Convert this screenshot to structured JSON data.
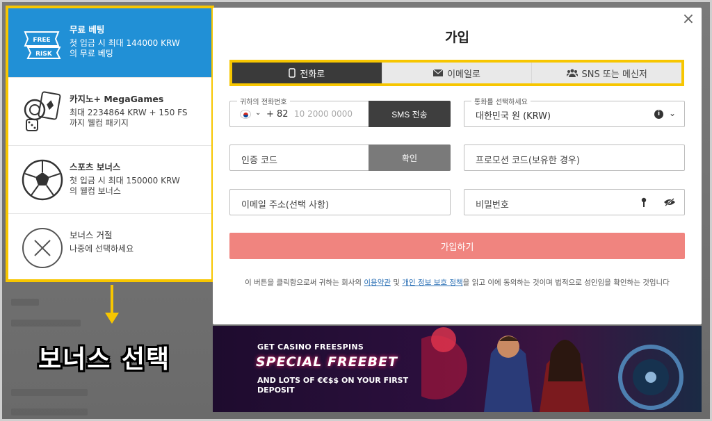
{
  "bonus_panel": {
    "items": [
      {
        "icon": "free-risk-icon",
        "icon_top": "FREE",
        "icon_bottom": "RISK",
        "title": "무료 베팅",
        "desc_1": "첫 입금 시 최대 144000 KRW",
        "desc_2": "의 무료 베팅"
      },
      {
        "icon": "casino-chips-cards-icon",
        "title": "카지노+ MegaGames",
        "desc_1": "최대 2234864 KRW + 150 FS",
        "desc_2": "까지 웰컴 패키지"
      },
      {
        "icon": "soccer-ball-icon",
        "title": "스포츠 보너스",
        "desc_1": "첫 입금 시 최대 150000 KRW",
        "desc_2": "의 웰컴 보너스"
      },
      {
        "icon": "x-circle-icon",
        "title": "보너스 거절",
        "desc_1": "나중에 선택하세요",
        "desc_2": ""
      }
    ],
    "caption": "보너스 선택"
  },
  "modal": {
    "title": "가입",
    "close": "×",
    "tabs": [
      {
        "label": "전화로",
        "icon": "phone-icon",
        "active": true
      },
      {
        "label": "이메일로",
        "icon": "envelope-icon",
        "active": false
      },
      {
        "label": "SNS 또는 메신저",
        "icon": "users-icon",
        "active": false
      }
    ],
    "phone": {
      "label": "귀하의 전화번호",
      "dial": "+ 82",
      "placeholder": "10 2000 0000",
      "sms_button": "SMS 전송"
    },
    "currency": {
      "label": "통화를 선택하세요",
      "value": "대한민국 원 (KRW)",
      "info": "i"
    },
    "code": {
      "placeholder": "인증 코드",
      "confirm_button": "확인"
    },
    "promo": {
      "placeholder": "프로모션 코드(보유한 경우)"
    },
    "email": {
      "placeholder": "이메일 주소(선택 사항)"
    },
    "password": {
      "placeholder": "비밀번호"
    },
    "signup_button": "가입하기",
    "terms": {
      "before": "이 버튼을 클릭함으로써 귀하는 회사의 ",
      "link1": "이용약관",
      "mid": " 및 ",
      "link2": "개인 정보 보호 정책",
      "after": "을 읽고 이에 동의하는 것이며 법적으로 성인임을 확인하는 것입니다"
    }
  },
  "banner": {
    "line1": "GET CASINO FREESPINS",
    "line2": "SPECIAL FREEBET",
    "line3": "AND LOTS OF €€$$ ON YOUR FIRST DEPOSIT"
  },
  "colors": {
    "accent_yellow": "#f7c600",
    "active_blue": "#2190d6",
    "signup_pink": "#f0847f",
    "dark_tab": "#3a3a3a"
  }
}
